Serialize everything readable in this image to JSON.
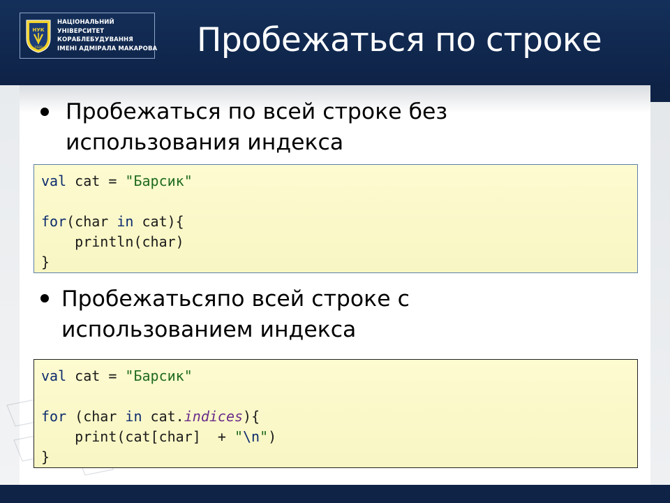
{
  "header": {
    "logo_lines": [
      "НАЦІОНАЛЬНИЙ",
      "УНІВЕРСИТЕТ",
      "КОРАБЛЕБУДУВАННЯ",
      "ІМЕНІ АДМІРАЛА МАКАРОВА"
    ],
    "emblem_text": "НУК",
    "emblem_year": "1920",
    "title": "Пробежаться по строке"
  },
  "bullets": [
    {
      "lines": [
        "Пробежаться по всей строке без",
        "использования индекса"
      ]
    },
    {
      "lines": [
        "Пробежатьсяпо всей строке с",
        "использованием индекса"
      ]
    }
  ],
  "code1": {
    "l1_kw": "val",
    "l1_mid": " cat = ",
    "l1_str": "\"Барсик\"",
    "l3_kw": "for",
    "l3_a": "(char ",
    "l3_in": "in",
    "l3_b": " cat){",
    "l4": "    println(char)",
    "l5": "}"
  },
  "code2": {
    "l1_kw": "val",
    "l1_mid": " cat = ",
    "l1_str": "\"Барсик\"",
    "l3_kw": "for",
    "l3_a": " (char ",
    "l3_in": "in",
    "l3_b": " cat.",
    "l3_prop": "indices",
    "l3_c": "){",
    "l4_a": "    print(cat[char]  + ",
    "l4_q1": "\"",
    "l4_esc": "\\n",
    "l4_q2": "\"",
    "l4_b": ")",
    "l5": "}"
  },
  "colors": {
    "header_bg": "#0f2346",
    "code_bg": "#fdfbd0",
    "keyword": "#0d2b6e",
    "string": "#1f6b1f",
    "property": "#6a2b8a"
  }
}
